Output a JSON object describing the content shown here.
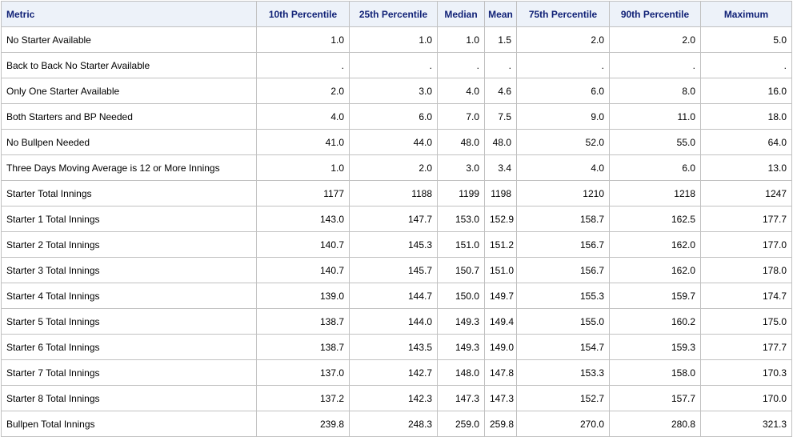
{
  "table": {
    "headers": [
      "Metric",
      "10th Percentile",
      "25th Percentile",
      "Median",
      "Mean",
      "75th Percentile",
      "90th Percentile",
      "Maximum"
    ],
    "rows": [
      [
        "No Starter Available",
        "1.0",
        "1.0",
        "1.0",
        "1.5",
        "2.0",
        "2.0",
        "5.0"
      ],
      [
        "Back to Back No Starter Available",
        ".",
        ".",
        ".",
        ".",
        ".",
        ".",
        "."
      ],
      [
        "Only One Starter Available",
        "2.0",
        "3.0",
        "4.0",
        "4.6",
        "6.0",
        "8.0",
        "16.0"
      ],
      [
        "Both Starters and BP Needed",
        "4.0",
        "6.0",
        "7.0",
        "7.5",
        "9.0",
        "11.0",
        "18.0"
      ],
      [
        "No Bullpen Needed",
        "41.0",
        "44.0",
        "48.0",
        "48.0",
        "52.0",
        "55.0",
        "64.0"
      ],
      [
        "Three Days Moving Average is 12 or More Innings",
        "1.0",
        "2.0",
        "3.0",
        "3.4",
        "4.0",
        "6.0",
        "13.0"
      ],
      [
        "Starter Total Innings",
        "1177",
        "1188",
        "1199",
        "1198",
        "1210",
        "1218",
        "1247"
      ],
      [
        "Starter 1 Total Innings",
        "143.0",
        "147.7",
        "153.0",
        "152.9",
        "158.7",
        "162.5",
        "177.7"
      ],
      [
        "Starter 2 Total Innings",
        "140.7",
        "145.3",
        "151.0",
        "151.2",
        "156.7",
        "162.0",
        "177.0"
      ],
      [
        "Starter 3 Total Innings",
        "140.7",
        "145.7",
        "150.7",
        "151.0",
        "156.7",
        "162.0",
        "178.0"
      ],
      [
        "Starter 4 Total Innings",
        "139.0",
        "144.7",
        "150.0",
        "149.7",
        "155.3",
        "159.7",
        "174.7"
      ],
      [
        "Starter 5 Total Innings",
        "138.7",
        "144.0",
        "149.3",
        "149.4",
        "155.0",
        "160.2",
        "175.0"
      ],
      [
        "Starter 6 Total Innings",
        "138.7",
        "143.5",
        "149.3",
        "149.0",
        "154.7",
        "159.3",
        "177.7"
      ],
      [
        "Starter 7 Total Innings",
        "137.0",
        "142.7",
        "148.0",
        "147.8",
        "153.3",
        "158.0",
        "170.3"
      ],
      [
        "Starter 8 Total Innings",
        "137.2",
        "142.3",
        "147.3",
        "147.3",
        "152.7",
        "157.7",
        "170.0"
      ],
      [
        "Bullpen Total Innings",
        "239.8",
        "248.3",
        "259.0",
        "259.8",
        "270.0",
        "280.8",
        "321.3"
      ]
    ]
  },
  "colors": {
    "header_background": "#edf2f9",
    "header_text": "#112277",
    "border": "#c1c1c1",
    "body_text": "#000000"
  }
}
